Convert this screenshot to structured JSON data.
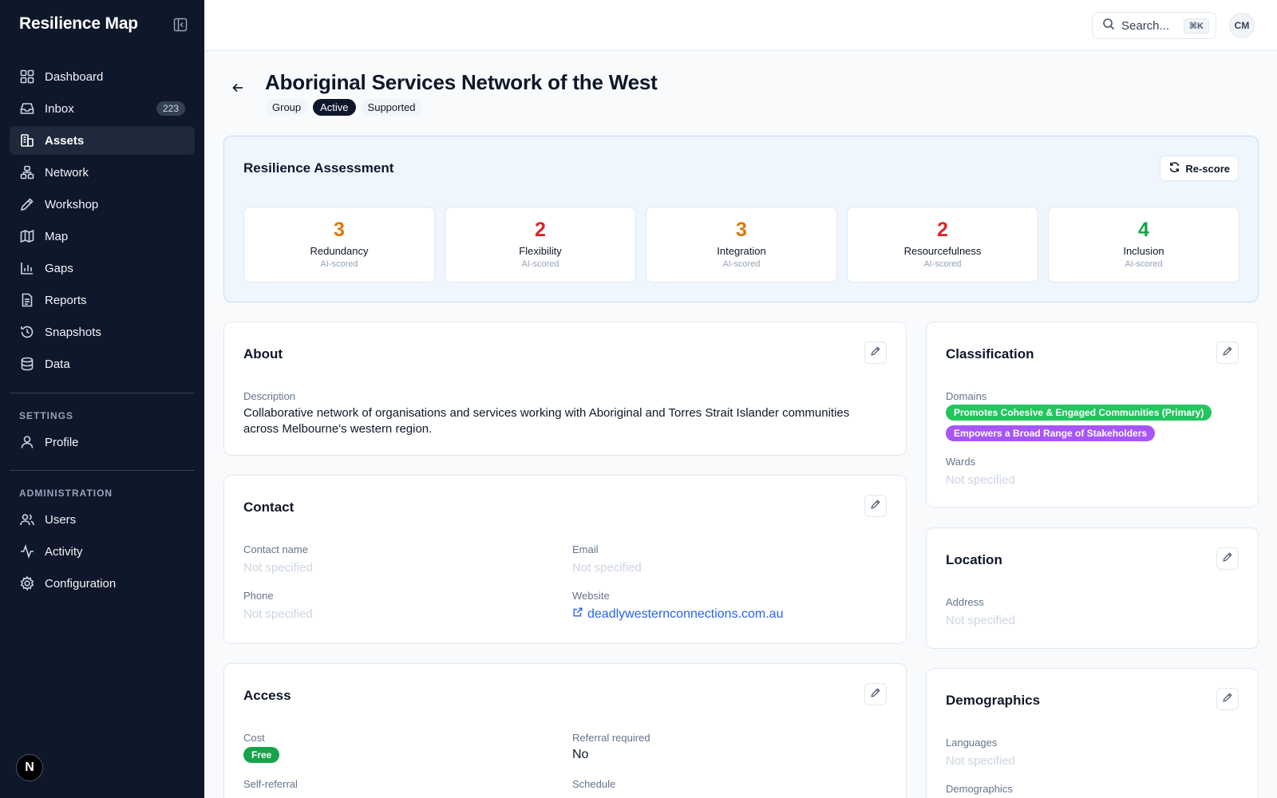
{
  "app": {
    "title": "Resilience Map"
  },
  "sidebar": {
    "items": [
      {
        "label": "Dashboard",
        "icon": "dashboard-icon"
      },
      {
        "label": "Inbox",
        "icon": "inbox-icon",
        "badge": "223"
      },
      {
        "label": "Assets",
        "icon": "assets-icon",
        "active": true
      },
      {
        "label": "Network",
        "icon": "network-icon"
      },
      {
        "label": "Workshop",
        "icon": "pencil-icon"
      },
      {
        "label": "Map",
        "icon": "map-icon"
      },
      {
        "label": "Gaps",
        "icon": "bar-chart-icon"
      },
      {
        "label": "Reports",
        "icon": "document-icon"
      },
      {
        "label": "Snapshots",
        "icon": "history-icon"
      },
      {
        "label": "Data",
        "icon": "database-icon"
      }
    ],
    "settings_title": "SETTINGS",
    "settings_items": [
      {
        "label": "Profile",
        "icon": "user-icon"
      }
    ],
    "admin_title": "ADMINISTRATION",
    "admin_items": [
      {
        "label": "Users",
        "icon": "users-icon"
      },
      {
        "label": "Activity",
        "icon": "activity-icon"
      },
      {
        "label": "Configuration",
        "icon": "gear-icon"
      }
    ],
    "footer_logo": "N"
  },
  "topbar": {
    "search_placeholder": "Search...",
    "shortcut": "⌘K",
    "avatar_initials": "CM"
  },
  "page": {
    "title": "Aboriginal Services Network of the West",
    "chips": [
      "Group",
      "Active",
      "Supported"
    ]
  },
  "assessment": {
    "title": "Resilience Assessment",
    "rescore_label": "Re-score",
    "scores": [
      {
        "value": "3",
        "name": "Redundancy",
        "sub": "AI-scored",
        "color": "#d97706"
      },
      {
        "value": "2",
        "name": "Flexibility",
        "sub": "AI-scored",
        "color": "#dc2626"
      },
      {
        "value": "3",
        "name": "Integration",
        "sub": "AI-scored",
        "color": "#d97706"
      },
      {
        "value": "2",
        "name": "Resourcefulness",
        "sub": "AI-scored",
        "color": "#dc2626"
      },
      {
        "value": "4",
        "name": "Inclusion",
        "sub": "AI-scored",
        "color": "#16a34a"
      }
    ]
  },
  "about": {
    "title": "About",
    "description_label": "Description",
    "description": "Collaborative network of organisations and services working with Aboriginal and Torres Strait Islander communities across Melbourne's western region."
  },
  "contact": {
    "title": "Contact",
    "contact_name_label": "Contact name",
    "contact_name_value": "Not specified",
    "email_label": "Email",
    "email_value": "Not specified",
    "phone_label": "Phone",
    "phone_value": "Not specified",
    "website_label": "Website",
    "website_value": "deadlywesternconnections.com.au"
  },
  "access": {
    "title": "Access",
    "cost_label": "Cost",
    "cost_value": "Free",
    "referral_label": "Referral required",
    "referral_value": "No",
    "self_referral_label": "Self-referral",
    "schedule_label": "Schedule"
  },
  "classification": {
    "title": "Classification",
    "domains_label": "Domains",
    "domains": [
      {
        "label": "Promotes Cohesive & Engaged Communities (Primary)",
        "color": "#22c55e"
      },
      {
        "label": "Empowers a Broad Range of Stakeholders",
        "color": "#a855f7"
      }
    ],
    "wards_label": "Wards",
    "wards_value": "Not specified"
  },
  "location": {
    "title": "Location",
    "address_label": "Address",
    "address_value": "Not specified"
  },
  "demographics": {
    "title": "Demographics",
    "languages_label": "Languages",
    "languages_value": "Not specified",
    "demographics_label": "Demographics"
  },
  "colors": {
    "sidebar_bg": "#0f172a",
    "accent_blue": "#2563eb",
    "free_green": "#16a34a"
  }
}
